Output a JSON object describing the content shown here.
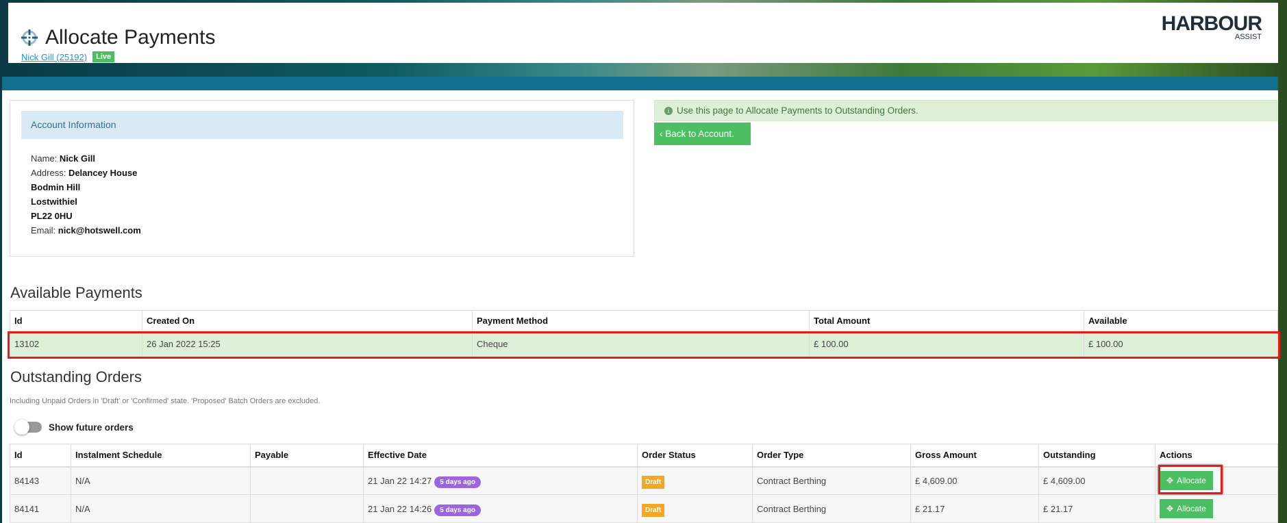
{
  "header": {
    "title": "Allocate Payments",
    "account_link": "Nick Gill (25192)",
    "badge": "Live",
    "logo_main": "HARBOUR",
    "logo_sub": "ASSIST"
  },
  "account": {
    "heading": "Account Information",
    "name_label": "Name:",
    "name": "Nick Gill",
    "address_label": "Address:",
    "address": [
      "Delancey House",
      "Bodmin Hill",
      "Lostwithiel",
      "PL22 0HU"
    ],
    "email_label": "Email:",
    "email": "nick@hotswell.com"
  },
  "alert": "Use this page to Allocate Payments to Outstanding Orders.",
  "back_button": "Back to Account.",
  "payments": {
    "heading": "Available Payments",
    "columns": [
      "Id",
      "Created On",
      "Payment Method",
      "Total Amount",
      "Available"
    ],
    "rows": [
      [
        "13102",
        "26 Jan 2022 15:25",
        "Cheque",
        "£ 100.00",
        "£ 100.00"
      ]
    ]
  },
  "orders": {
    "heading": "Outstanding Orders",
    "note": "Including Unpaid Orders in 'Draft' or 'Confirmed' state. 'Proposed' Batch Orders are excluded.",
    "toggle_label": "Show future orders",
    "columns": [
      "Id",
      "Instalment Schedule",
      "Payable",
      "Effective Date",
      "Order Status",
      "Order Type",
      "Gross Amount",
      "Outstanding",
      "Actions"
    ],
    "rows": [
      {
        "id": "84143",
        "schedule": "N/A",
        "payable": "",
        "date": "21 Jan 22 14:27",
        "ago": "5 days ago",
        "status": "Draft",
        "type": "Contract Berthing",
        "gross": "£ 4,609.00",
        "outstanding": "£ 4,609.00",
        "action": "Allocate"
      },
      {
        "id": "84141",
        "schedule": "N/A",
        "payable": "",
        "date": "21 Jan 22 14:26",
        "ago": "5 days ago",
        "status": "Draft",
        "type": "Contract Berthing",
        "gross": "£ 21.17",
        "outstanding": "£ 21.17",
        "action": "Allocate"
      }
    ]
  }
}
